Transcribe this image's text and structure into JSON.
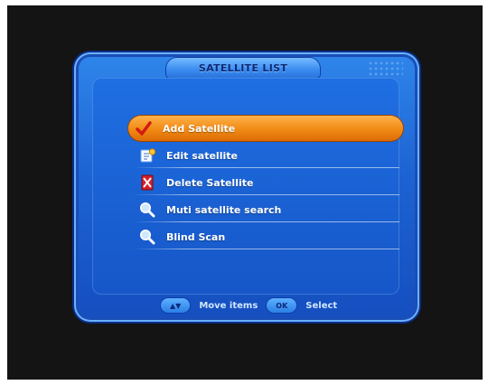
{
  "window": {
    "title": "SATELLITE LIST"
  },
  "menu": {
    "items": [
      {
        "label": "Add Satellite",
        "icon": "checkmark-icon",
        "selected": true
      },
      {
        "label": "Edit satellite",
        "icon": "edit-icon",
        "selected": false
      },
      {
        "label": "Delete Satellite",
        "icon": "delete-icon",
        "selected": false
      },
      {
        "label": "Muti satellite search",
        "icon": "search-icon",
        "selected": false
      },
      {
        "label": "Blind Scan",
        "icon": "search-icon",
        "selected": false
      }
    ]
  },
  "footer": {
    "hints": [
      {
        "key": "▲▼",
        "text": "Move items"
      },
      {
        "key": "OK",
        "text": "Select"
      }
    ]
  },
  "colors": {
    "panel": "#1d63d3",
    "highlight": "#f08a14",
    "text": "#ffffff",
    "background": "#141414"
  }
}
